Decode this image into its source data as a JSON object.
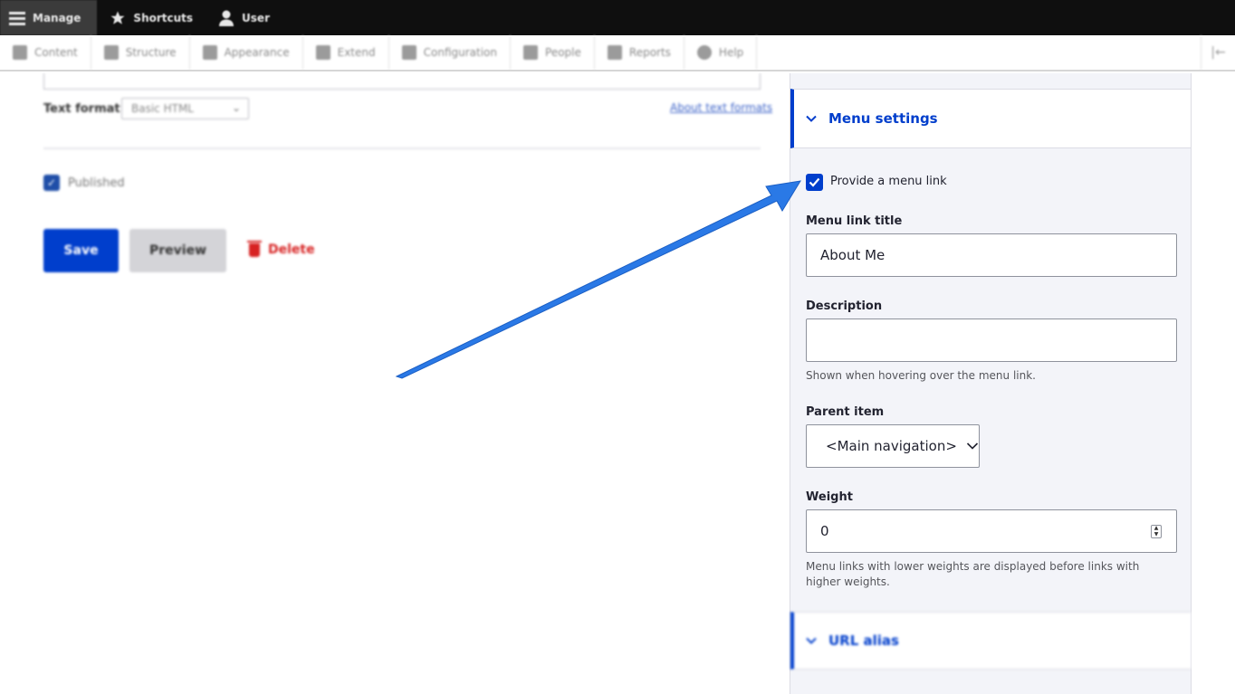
{
  "topbar": {
    "items": [
      {
        "label": "Manage",
        "icon": "hamburger-icon"
      },
      {
        "label": "Shortcuts",
        "icon": "star-icon"
      },
      {
        "label": "User",
        "icon": "user-icon"
      }
    ]
  },
  "tray": {
    "items": [
      {
        "label": "Content"
      },
      {
        "label": "Structure"
      },
      {
        "label": "Appearance"
      },
      {
        "label": "Extend"
      },
      {
        "label": "Configuration"
      },
      {
        "label": "People"
      },
      {
        "label": "Reports"
      },
      {
        "label": "Help"
      }
    ]
  },
  "form": {
    "text_format_label": "Text format",
    "text_format_value": "Basic HTML",
    "about_text_formats": "About text formats",
    "published_label": "Published",
    "published_checked": true,
    "save_label": "Save",
    "preview_label": "Preview",
    "delete_label": "Delete"
  },
  "menu_settings": {
    "title": "Menu settings",
    "provide_link_label": "Provide a menu link",
    "provide_link_checked": true,
    "link_title_label": "Menu link title",
    "link_title_value": "About Me",
    "description_label": "Description",
    "description_value": "",
    "description_help": "Shown when hovering over the menu link.",
    "parent_item_label": "Parent item",
    "parent_item_value": "<Main navigation>",
    "weight_label": "Weight",
    "weight_value": "0",
    "weight_help": "Menu links with lower weights are displayed before links with higher weights."
  },
  "url_alias": {
    "title": "URL alias"
  },
  "colors": {
    "accent": "#003ecc",
    "arrow": "#2a79e6",
    "delete": "#d72222"
  }
}
